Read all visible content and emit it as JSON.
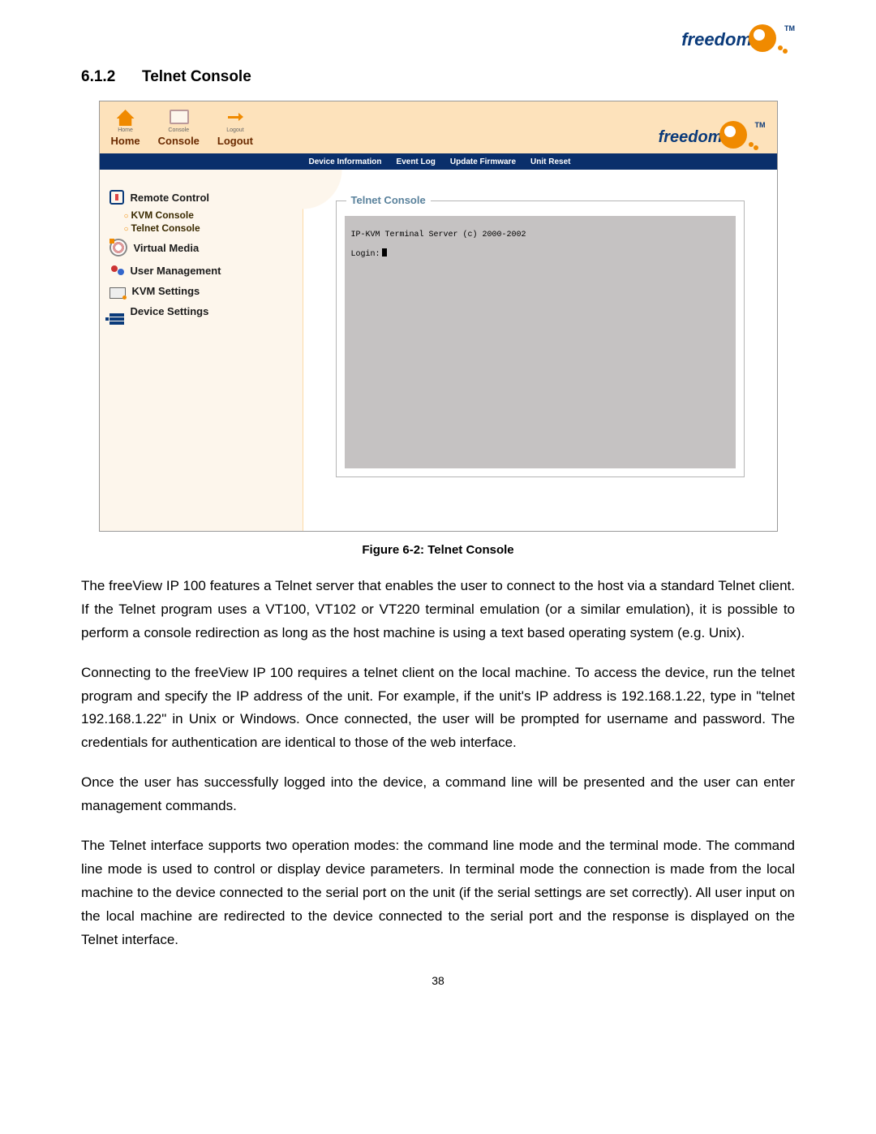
{
  "logo_text": "freedom",
  "logo_tm": "TM",
  "section": {
    "number": "6.1.2",
    "title": "Telnet Console"
  },
  "screenshot": {
    "topnav": {
      "home_tiny": "Home",
      "home_label": "Home",
      "console_tiny": "Console",
      "console_label": "Console",
      "logout_tiny": "Logout",
      "logout_label": "Logout"
    },
    "bluebar": [
      "Device Information",
      "Event Log",
      "Update Firmware",
      "Unit Reset"
    ],
    "sidebar": {
      "remote": "Remote Control",
      "kvm_console": "KVM Console",
      "telnet_console": "Telnet Console",
      "virtual_media": "Virtual Media",
      "user_mgmt": "User Management",
      "kvm_settings": "KVM Settings",
      "device_settings": "Device Settings"
    },
    "telnet": {
      "legend": "Telnet Console",
      "line1": "IP-KVM Terminal Server (c) 2000-2002",
      "line2": "Login:"
    }
  },
  "figure_caption": "Figure 6-2: Telnet Console",
  "paragraphs": {
    "p1": "The freeView IP 100 features a Telnet server that enables the user to connect to the host via a standard Telnet client. If the Telnet program uses a VT100, VT102 or VT220 terminal emulation (or a similar emulation), it is possible to perform a console redirection as long as the host machine is using a text based operating system (e.g. Unix).",
    "p2": "Connecting to the freeView IP 100 requires a telnet client on the local machine. To access the device, run the telnet program and specify the IP address of the unit. For example, if the unit's IP address is 192.168.1.22, type in \"telnet 192.168.1.22\" in Unix or Windows. Once connected, the user will be prompted for username and password. The credentials for authentication are identical to those of the web interface.",
    "p3": "Once the user has successfully logged into the device, a command line will be presented and the user can enter management commands.",
    "p4": "The Telnet interface supports two operation modes: the command line mode and the terminal mode. The command line mode is used to control or display device parameters. In terminal mode the connection is made from the local machine to the device connected to the serial port on the unit (if the serial settings are set correctly). All user input on the local machine are redirected to the device connected to the serial port and the response is displayed on the Telnet interface."
  },
  "page_number": "38"
}
